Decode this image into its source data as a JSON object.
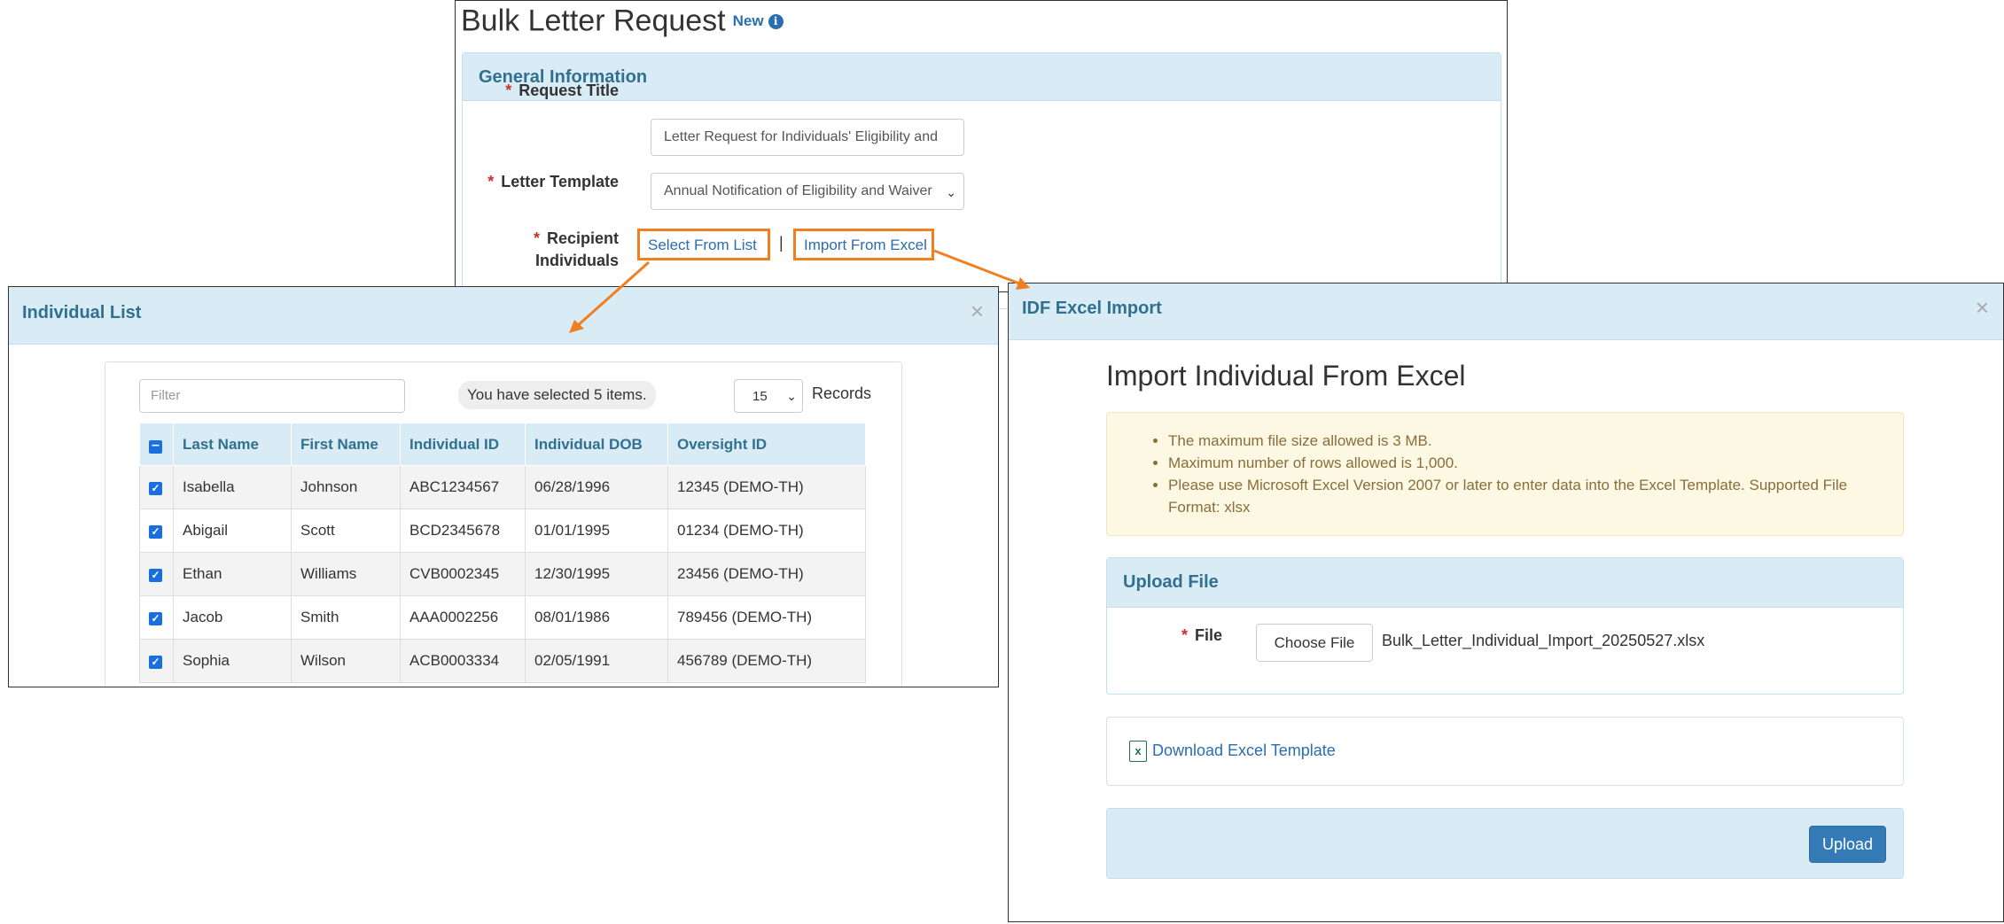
{
  "main": {
    "title": "Bulk Letter Request",
    "new_badge": "New",
    "info_icon": "info-circle-icon",
    "general_panel_title": "General Information",
    "request_title": {
      "label": "Request Title",
      "value": "Letter Request for Individuals' Eligibility and"
    },
    "letter_template": {
      "label": "Letter Template",
      "value": "Annual Notification of Eligibility and Waiver"
    },
    "recipients": {
      "label_line1": "Recipient",
      "label_line2": "Individuals",
      "select_link": "Select From List",
      "separator": "|",
      "import_link": "Import From Excel"
    },
    "required_marker": "*"
  },
  "individual_modal": {
    "title": "Individual List",
    "close": "×",
    "filter_placeholder": "Filter",
    "selected_info": "You have selected 5 items.",
    "page_size": "15",
    "records_label": "Records",
    "columns": [
      "Last Name",
      "First Name",
      "Individual ID",
      "Individual DOB",
      "Oversight ID"
    ],
    "rows": [
      {
        "checked": true,
        "cells": [
          "Isabella",
          "Johnson",
          "ABC1234567",
          "06/28/1996",
          "12345 (DEMO-TH)"
        ]
      },
      {
        "checked": true,
        "cells": [
          "Abigail",
          "Scott",
          "BCD2345678",
          "01/01/1995",
          "01234 (DEMO-TH)"
        ]
      },
      {
        "checked": true,
        "cells": [
          "Ethan",
          "Williams",
          "CVB0002345",
          "12/30/1995",
          "23456 (DEMO-TH)"
        ]
      },
      {
        "checked": true,
        "cells": [
          "Jacob",
          "Smith",
          "AAA0002256",
          "08/01/1986",
          "789456 (DEMO-TH)"
        ]
      },
      {
        "checked": true,
        "cells": [
          "Sophia",
          "Wilson",
          "ACB0003334",
          "02/05/1991",
          "456789 (DEMO-TH)"
        ]
      }
    ]
  },
  "import_modal": {
    "title": "IDF Excel Import",
    "close": "×",
    "heading": "Import Individual From Excel",
    "notes": [
      "The maximum file size allowed is 3 MB.",
      "Maximum number of rows allowed is 1,000.",
      "Please use Microsoft Excel Version 2007 or later to enter data into the Excel Template. Supported File Format: xlsx"
    ],
    "upload_panel_title": "Upload File",
    "file_label": "File",
    "choose_file": "Choose File",
    "file_name": "Bulk_Letter_Individual_Import_20250527.xlsx",
    "excel_icon": "excel-file-icon",
    "download_template": "Download Excel Template",
    "upload_button": "Upload"
  },
  "colors": {
    "accent_arrow": "#f07f1f",
    "panel_header": "#d9ecf5",
    "panel_title_text": "#31708f",
    "link": "#2a6db0",
    "primary_button": "#337ab7"
  }
}
